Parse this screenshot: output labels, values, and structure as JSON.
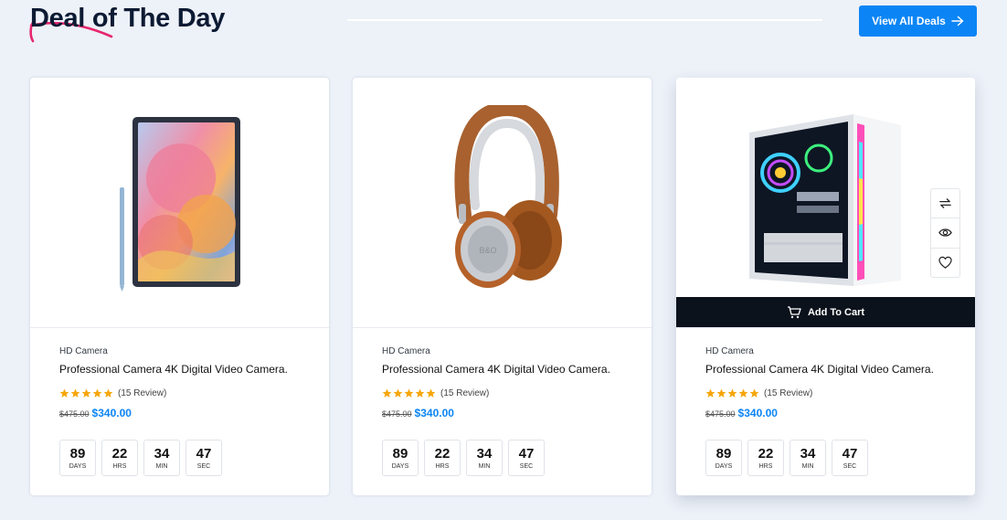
{
  "header": {
    "title": "Deal of The Day",
    "view_all_label": "View All Deals"
  },
  "colors": {
    "accent": "#0b85f5",
    "title": "#0c1a33",
    "swash": "#e6266d",
    "star": "#f6a609",
    "cart_bar": "#0c121c"
  },
  "cards": [
    {
      "image": "tablet",
      "category": "HD Camera",
      "name": "Professional Camera 4K Digital Video Camera.",
      "rating": 5,
      "reviews": "(15 Review)",
      "old_price": "$475.00",
      "new_price": "$340.00",
      "timer": [
        {
          "value": "89",
          "label": "DAYS"
        },
        {
          "value": "22",
          "label": "HRS"
        },
        {
          "value": "34",
          "label": "MIN"
        },
        {
          "value": "47",
          "label": "SEC"
        }
      ]
    },
    {
      "image": "headphones",
      "category": "HD Camera",
      "name": "Professional Camera 4K Digital Video Camera.",
      "rating": 5,
      "reviews": "(15 Review)",
      "old_price": "$475.00",
      "new_price": "$340.00",
      "timer": [
        {
          "value": "89",
          "label": "DAYS"
        },
        {
          "value": "22",
          "label": "HRS"
        },
        {
          "value": "34",
          "label": "MIN"
        },
        {
          "value": "47",
          "label": "SEC"
        }
      ]
    },
    {
      "image": "pc-case",
      "category": "HD Camera",
      "name": "Professional Camera 4K Digital Video Camera.",
      "rating": 5,
      "reviews": "(15 Review)",
      "old_price": "$475.00",
      "new_price": "$340.00",
      "add_to_cart_label": "Add To Cart",
      "action_icons": [
        "compare-icon",
        "eye-icon",
        "heart-icon"
      ],
      "timer": [
        {
          "value": "89",
          "label": "DAYS"
        },
        {
          "value": "22",
          "label": "HRS"
        },
        {
          "value": "34",
          "label": "MIN"
        },
        {
          "value": "47",
          "label": "SEC"
        }
      ]
    }
  ]
}
